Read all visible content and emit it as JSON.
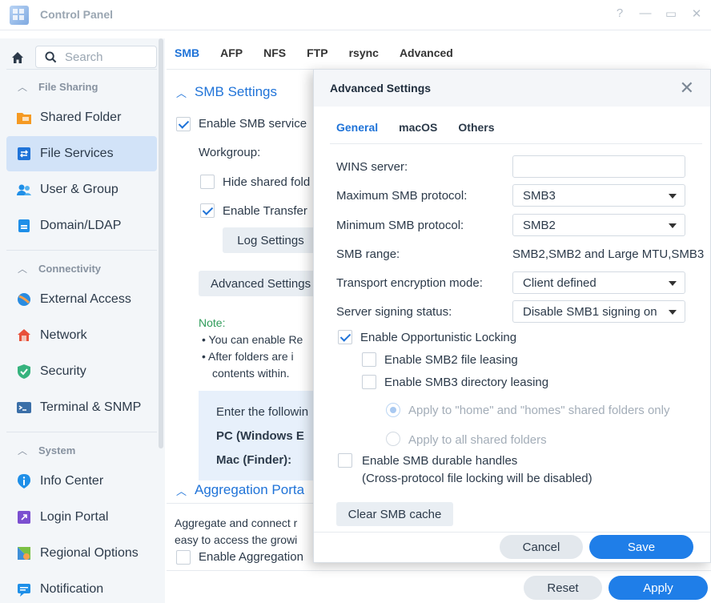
{
  "window": {
    "title": "Control Panel",
    "controls": [
      "?",
      "—",
      "▭",
      "✕"
    ]
  },
  "sidebar": {
    "search_placeholder": "Search",
    "sections": [
      {
        "label": "File Sharing"
      },
      {
        "label": "Connectivity"
      },
      {
        "label": "System"
      }
    ],
    "items": [
      {
        "label": "Shared Folder",
        "icon": "folder-icon",
        "color": "#f59a23"
      },
      {
        "label": "File Services",
        "icon": "file-services-icon",
        "color": "#1f73d8"
      },
      {
        "label": "User & Group",
        "icon": "users-icon",
        "color": "#1f8fe8"
      },
      {
        "label": "Domain/LDAP",
        "icon": "domain-icon",
        "color": "#1f8fe8"
      },
      {
        "label": "External Access",
        "icon": "external-access-icon",
        "color": "#2a8ce0"
      },
      {
        "label": "Network",
        "icon": "network-icon",
        "color": "#e8503a"
      },
      {
        "label": "Security",
        "icon": "security-icon",
        "color": "#36b37e"
      },
      {
        "label": "Terminal & SNMP",
        "icon": "terminal-icon",
        "color": "#3b6fa8"
      },
      {
        "label": "Info Center",
        "icon": "info-icon",
        "color": "#1f8fe8"
      },
      {
        "label": "Login Portal",
        "icon": "login-portal-icon",
        "color": "#7b4fd0"
      },
      {
        "label": "Regional Options",
        "icon": "regional-icon",
        "color": "#3f8fd8"
      },
      {
        "label": "Notification",
        "icon": "notification-icon",
        "color": "#1f8fe8"
      }
    ]
  },
  "main": {
    "tabs": [
      "SMB",
      "AFP",
      "NFS",
      "FTP",
      "rsync",
      "Advanced"
    ],
    "smb_settings_title": "SMB Settings",
    "enable_smb": "Enable SMB service",
    "workgroup": "Workgroup:",
    "hide_shared": "Hide shared fold",
    "enable_transfer": "Enable Transfer",
    "log_settings": "Log Settings",
    "advanced_settings": "Advanced Settings",
    "note_label": "Note:",
    "note_1": "• You can enable Re",
    "note_2": "• After folders are i",
    "note_3": "contents within.",
    "info_enter": "Enter the followin",
    "info_pc": "PC (Windows E",
    "info_mac": "Mac (Finder):",
    "aggregation_title": "Aggregation Porta",
    "agg_text_1": "Aggregate and connect r",
    "agg_text_2": "easy to access the growi",
    "enable_aggregation": "Enable Aggregation",
    "reset": "Reset",
    "apply": "Apply"
  },
  "dialog": {
    "title": "Advanced Settings",
    "close": "✕",
    "tabs": [
      "General",
      "macOS",
      "Others"
    ],
    "wins_label": "WINS server:",
    "wins_value": "",
    "max_label": "Maximum SMB protocol:",
    "max_value": "SMB3",
    "min_label": "Minimum SMB protocol:",
    "min_value": "SMB2",
    "range_label": "SMB range:",
    "range_value": "SMB2,SMB2 and Large MTU,SMB3",
    "enc_label": "Transport encryption mode:",
    "enc_value": "Client defined",
    "sign_label": "Server signing status:",
    "sign_value": "Disable SMB1 signing on",
    "oplock": "Enable Opportunistic Locking",
    "smb2_lease": "Enable SMB2 file leasing",
    "smb3_dir": "Enable SMB3 directory leasing",
    "apply_home": "Apply to \"home\" and \"homes\" shared folders only",
    "apply_all": "Apply to all shared folders",
    "durable": "Enable SMB durable handles",
    "durable_note": "(Cross-protocol file locking will be disabled)",
    "clear_cache": "Clear SMB cache",
    "cancel": "Cancel",
    "save": "Save"
  }
}
